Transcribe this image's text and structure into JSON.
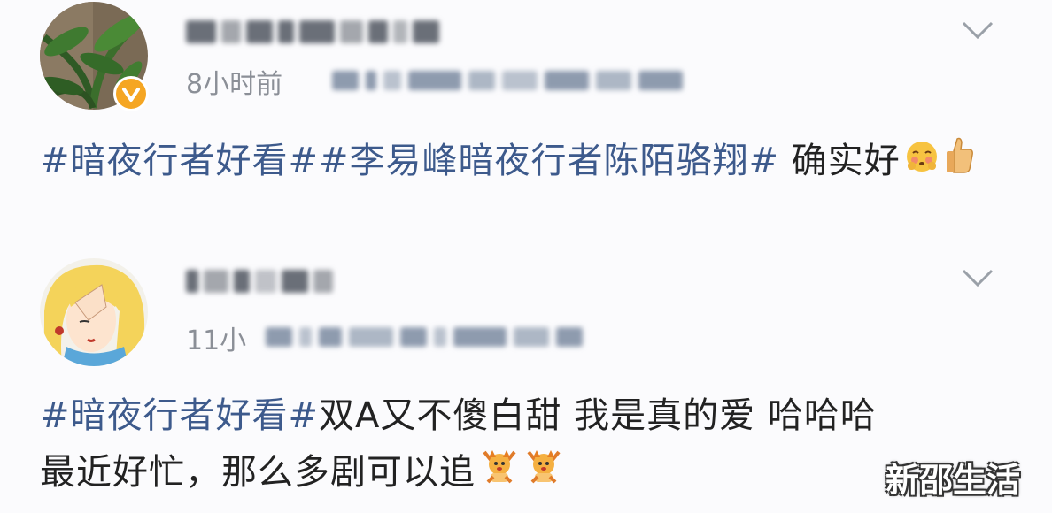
{
  "posts": [
    {
      "time": "8小时前",
      "content": {
        "tag1": "#暗夜行者好看#",
        "tag2": "#李易峰暗夜行者陈陌骆翔#",
        "text": " 确实好"
      },
      "avatar_icon": "plant-avatar",
      "badge_icon": "verified-badge-icon",
      "emojis": [
        "shy-face-emoji",
        "thumbs-up-emoji"
      ]
    },
    {
      "time": "11小",
      "content": {
        "tag1": "#暗夜行者好看#",
        "text1": "双A又不傻白甜 我是真的爱 哈哈哈",
        "text2": "最近好忙，那么多剧可以追"
      },
      "avatar_icon": "cartoon-girl-avatar",
      "emojis": [
        "dancing-fox-emoji",
        "dancing-fox-emoji"
      ]
    }
  ],
  "watermark": "新邵生活",
  "colors": {
    "tag": "#3d5a8c",
    "text": "#222222",
    "time": "#8b8f97",
    "badge": "#f5a623"
  }
}
